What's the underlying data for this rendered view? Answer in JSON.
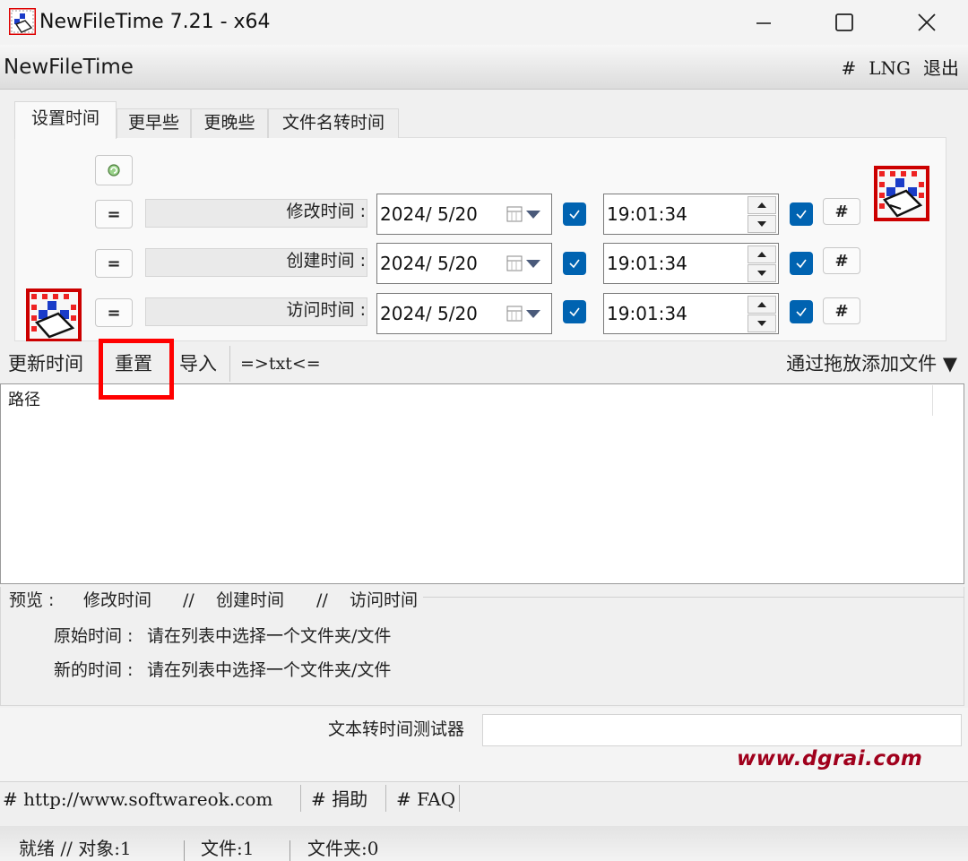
{
  "window": {
    "title": "NewFileTime 7.21 - x64",
    "app_name": "NewFileTime"
  },
  "menu": {
    "hash": "#",
    "lng": "LNG",
    "exit": "退出"
  },
  "tabs": [
    {
      "label": "设置时间",
      "active": true
    },
    {
      "label": "更早些",
      "active": false
    },
    {
      "label": "更晚些",
      "active": false
    },
    {
      "label": "文件名转时间",
      "active": false
    }
  ],
  "time_rows": [
    {
      "eq": "=",
      "label": "修改时间 :",
      "date": "2024/  5/20",
      "time": "19:01:34",
      "hash": "#"
    },
    {
      "eq": "=",
      "label": "创建时间 :",
      "date": "2024/  5/20",
      "time": "19:01:34",
      "hash": "#"
    },
    {
      "eq": "=",
      "label": "访问时间 :",
      "date": "2024/  5/20",
      "time": "19:01:34",
      "hash": "#"
    }
  ],
  "toolbar": {
    "update": "更新时间",
    "reset": "重置",
    "import": "导入",
    "txt": "=>txt<=",
    "drag_add": "通过拖放添加文件 ▼"
  },
  "list": {
    "column_path": "路径"
  },
  "preview": {
    "header_prefix": "预览 :",
    "header_modified": "修改时间",
    "sep": "//",
    "header_created": "创建时间",
    "header_accessed": "访问时间",
    "original_label": "原始时间 :",
    "original_value": "请在列表中选择一个文件夹/文件",
    "new_label": "新的时间 :",
    "new_value": "请在列表中选择一个文件夹/文件"
  },
  "tester": {
    "label": "文本转时间测试器",
    "value": ""
  },
  "watermark": "www.dgrai.com",
  "links": {
    "website": "# http://www.softwareok.com",
    "donate": "# 捐助",
    "faq": "# FAQ"
  },
  "status": {
    "ready": "就绪 // 对象:1",
    "files": "文件:1",
    "folders": "文件夹:0"
  },
  "colors": {
    "accent": "#0063b1",
    "highlight": "#ff0000",
    "watermark": "#a0001c"
  }
}
